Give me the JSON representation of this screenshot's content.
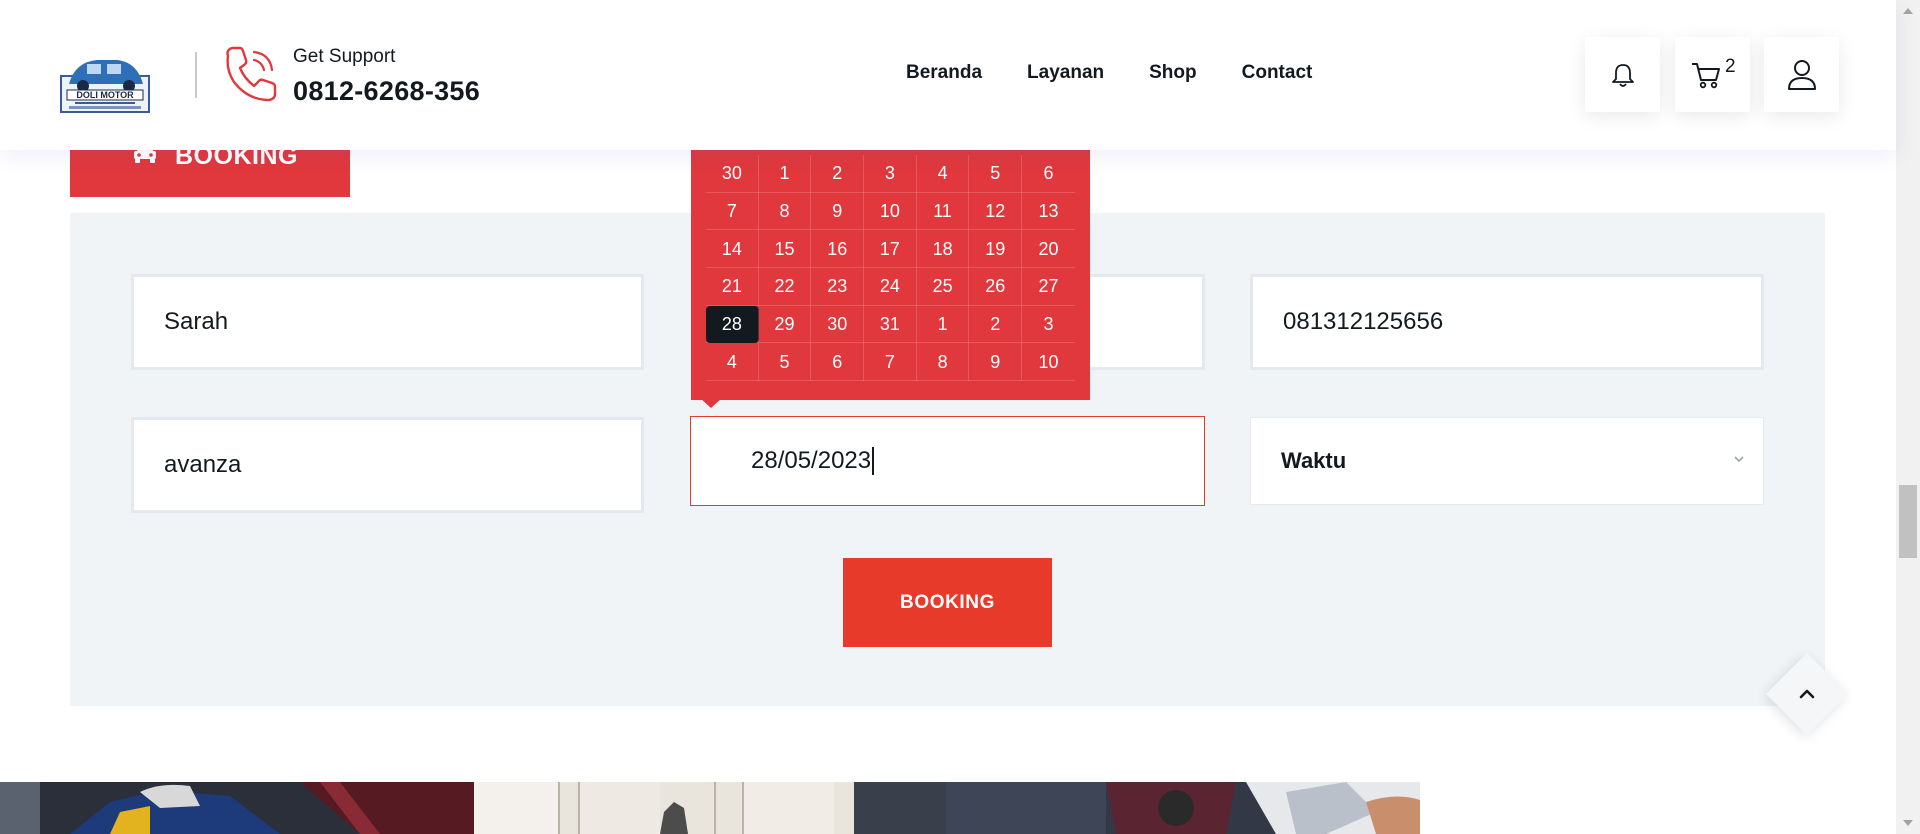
{
  "header": {
    "logo_icon": "doli-motor-logo",
    "phone_icon": "phone-icon",
    "support_label": "Get Support",
    "support_phone": "0812-6268-356",
    "nav": [
      "Beranda",
      "Layanan",
      "Shop",
      "Contact"
    ],
    "notification_icon": "bell-icon",
    "cart_icon": "cart-icon",
    "cart_count": "2",
    "account_icon": "user-icon"
  },
  "tab": {
    "icon": "car-icon",
    "label": "BOOKING"
  },
  "form": {
    "name_value": "Sarah",
    "phone_value": "081312125656",
    "car_value": "avanza",
    "date_value": "28/05/2023",
    "time_label": "Waktu",
    "submit_label": "BOOKING"
  },
  "datepicker": {
    "weeks": [
      [
        "30",
        "1",
        "2",
        "3",
        "4",
        "5",
        "6"
      ],
      [
        "7",
        "8",
        "9",
        "10",
        "11",
        "12",
        "13"
      ],
      [
        "14",
        "15",
        "16",
        "17",
        "18",
        "19",
        "20"
      ],
      [
        "21",
        "22",
        "23",
        "24",
        "25",
        "26",
        "27"
      ],
      [
        "28",
        "29",
        "30",
        "31",
        "1",
        "2",
        "3"
      ],
      [
        "4",
        "5",
        "6",
        "7",
        "8",
        "9",
        "10"
      ]
    ],
    "selected": "28"
  },
  "scroll_top_icon": "chevron-up-icon",
  "colors": {
    "accent": "#e83a2b",
    "tab": "#e0383c",
    "panel": "#f1f4f6",
    "text": "#121a1f"
  }
}
